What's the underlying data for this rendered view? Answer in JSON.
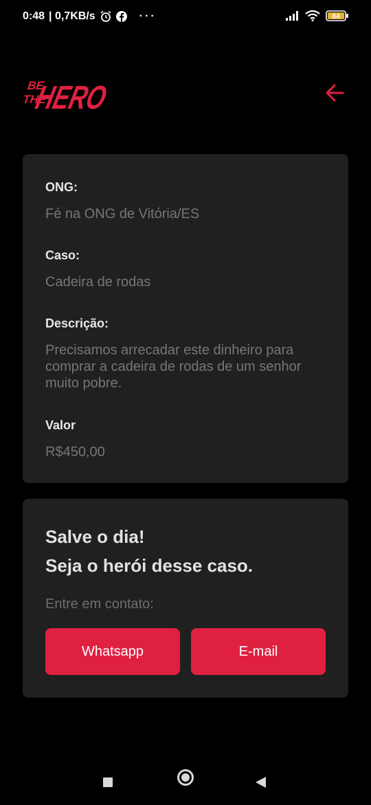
{
  "status_bar": {
    "time": "0:48",
    "speed": "| 0,7KB/s",
    "more": "···",
    "battery": "84",
    "icons": [
      "alarm-icon",
      "facebook-icon",
      "signal-icon",
      "wifi-icon",
      "battery-icon"
    ]
  },
  "header": {
    "logo_text_small_top": "BE",
    "logo_text_small_bottom": "THE",
    "logo_text_big": "HERO",
    "back_icon": "arrow-left-icon"
  },
  "incident": {
    "ong_label": "ONG:",
    "ong_value": "Fé na ONG de Vitória/ES",
    "caso_label": "Caso:",
    "caso_value": "Cadeira de rodas",
    "descricao_label": "Descrição:",
    "descricao_value": "Precisamos arrecadar este dinheiro para comprar a cadeira de rodas  de um senhor muito pobre.",
    "valor_label": "Valor",
    "valor_value": "R$450,00"
  },
  "contact": {
    "title_line1": "Salve o dia!",
    "title_line2": "Seja o herói desse caso.",
    "contact_label": "Entre em contato:",
    "whatsapp_label": "Whatsapp",
    "email_label": "E-mail"
  },
  "colors": {
    "accent": "#e02041",
    "background": "#000000",
    "card": "#202020"
  }
}
